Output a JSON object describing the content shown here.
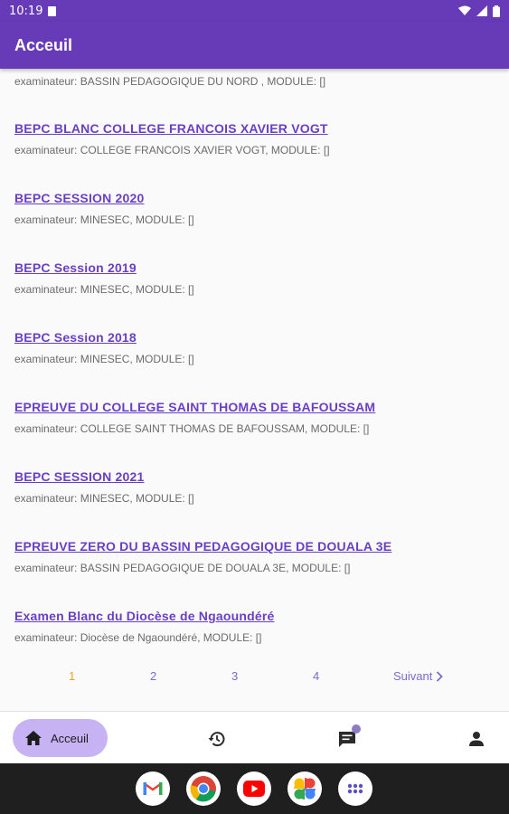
{
  "status_bar": {
    "time": "10:19"
  },
  "app_bar": {
    "title": "Acceuil"
  },
  "partial_item": {
    "subtitle": "examinateur: BASSIN PEDAGOGIQUE DU NORD ,   MODULE: []"
  },
  "items": [
    {
      "title": "BEPC BLANC COLLEGE FRANCOIS XAVIER VOGT",
      "subtitle": "examinateur: COLLEGE FRANCOIS XAVIER VOGT,   MODULE: []"
    },
    {
      "title": "BEPC SESSION 2020",
      "subtitle": "examinateur: MINESEC,   MODULE: []"
    },
    {
      "title": "BEPC Session 2019",
      "subtitle": "examinateur: MINESEC,   MODULE: []"
    },
    {
      "title": "BEPC Session 2018",
      "subtitle": "examinateur: MINESEC,   MODULE: []"
    },
    {
      "title": "EPREUVE DU COLLEGE SAINT THOMAS DE BAFOUSSAM",
      "subtitle": "examinateur: COLLEGE SAINT THOMAS DE BAFOUSSAM,   MODULE: []"
    },
    {
      "title": "BEPC SESSION 2021",
      "subtitle": "examinateur: MINESEC,   MODULE: []"
    },
    {
      "title": "EPREUVE ZERO DU BASSIN PEDAGOGIQUE DE DOUALA 3E",
      "subtitle": "examinateur: BASSIN PEDAGOGIQUE DE DOUALA 3E,   MODULE: []"
    },
    {
      "title": "Examen Blanc du Diocèse de Ngaoundéré",
      "subtitle": "examinateur: Diocèse de Ngaoundéré,   MODULE: []"
    }
  ],
  "pagination": {
    "pages": [
      "1",
      "2",
      "3",
      "4"
    ],
    "current": "1",
    "next_label": "Suivant"
  },
  "bottom_nav": {
    "home_label": "Acceuil"
  },
  "colors": {
    "primary": "#673ab7",
    "link": "#6a3fc8",
    "active_page": "#e0a62a",
    "nav_pill": "#c7b3f4"
  },
  "dock": [
    "gmail-icon",
    "chrome-icon",
    "youtube-icon",
    "photos-icon",
    "apps-icon"
  ]
}
